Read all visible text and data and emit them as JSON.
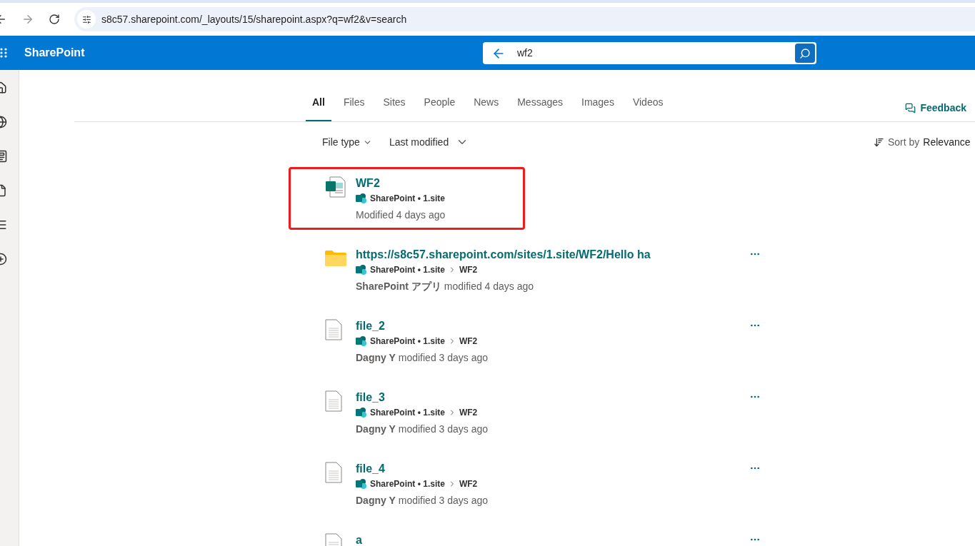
{
  "browser": {
    "url": "s8c57.sharepoint.com/_layouts/15/sharepoint.aspx?q=wf2&v=search"
  },
  "suite_bar": {
    "app_name": "SharePoint",
    "search": {
      "value": "wf2"
    }
  },
  "tabs": [
    {
      "label": "All",
      "selected": true
    },
    {
      "label": "Files",
      "selected": false
    },
    {
      "label": "Sites",
      "selected": false
    },
    {
      "label": "People",
      "selected": false
    },
    {
      "label": "News",
      "selected": false
    },
    {
      "label": "Messages",
      "selected": false
    },
    {
      "label": "Images",
      "selected": false
    },
    {
      "label": "Videos",
      "selected": false
    }
  ],
  "feedback": "Feedback",
  "filters": [
    {
      "label": "File type",
      "kind": "small"
    },
    {
      "label": "Last modified",
      "kind": "large"
    }
  ],
  "sort": {
    "label": "Sort by",
    "value": "Relevance"
  },
  "results": [
    {
      "kind": "sitepage",
      "title": "WF2",
      "site": "SharePoint • 1.site",
      "modified": "Modified 4 days ago",
      "highlighted": true
    },
    {
      "kind": "folder",
      "title": "https://s8c57.sharepoint.com/sites/1.site/WF2/Hello ha",
      "site": "SharePoint • 1.site",
      "path": "WF2",
      "author": "SharePoint アプリ",
      "modified": "modified 4 days ago",
      "highlighted": false
    },
    {
      "kind": "file",
      "title": "file_2",
      "site": "SharePoint • 1.site",
      "path": "WF2",
      "author": "Dagny Y",
      "modified": "modified 3 days ago",
      "highlighted": false
    },
    {
      "kind": "file",
      "title": "file_3",
      "site": "SharePoint • 1.site",
      "path": "WF2",
      "author": "Dagny Y",
      "modified": "modified 3 days ago",
      "highlighted": false
    },
    {
      "kind": "file",
      "title": "file_4",
      "site": "SharePoint • 1.site",
      "path": "WF2",
      "author": "Dagny Y",
      "modified": "modified 3 days ago",
      "highlighted": false
    },
    {
      "kind": "file",
      "title": "a",
      "highlighted": false
    }
  ]
}
